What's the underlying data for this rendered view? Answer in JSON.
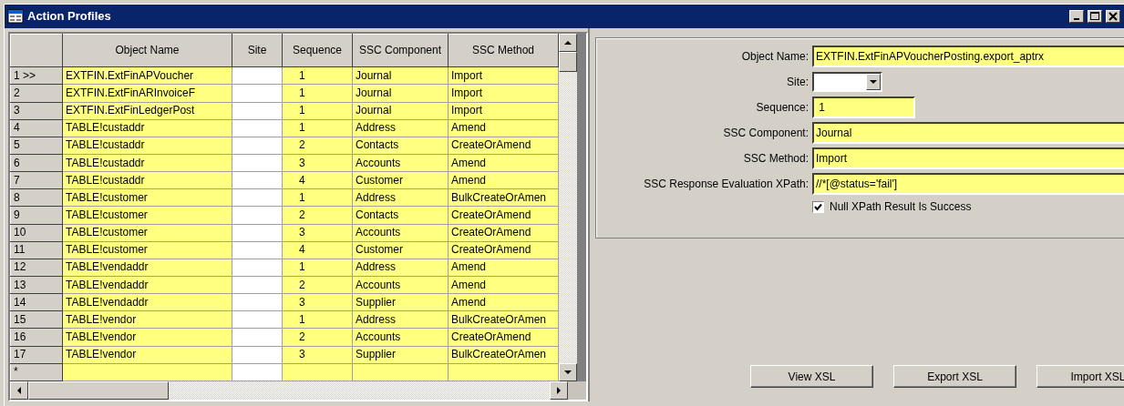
{
  "window": {
    "title": "Action Profiles"
  },
  "grid": {
    "columns": [
      "Object Name",
      "Site",
      "Sequence",
      "SSC Component",
      "SSC Method"
    ],
    "rows": [
      {
        "header": "1 >>",
        "cells": [
          "EXTFIN.ExtFinAPVoucher",
          "",
          "1",
          "Journal",
          "Import"
        ]
      },
      {
        "header": "2",
        "cells": [
          "EXTFIN.ExtFinARInvoiceF",
          "",
          "1",
          "Journal",
          "Import"
        ]
      },
      {
        "header": "3",
        "cells": [
          "EXTFIN.ExtFinLedgerPost",
          "",
          "1",
          "Journal",
          "Import"
        ]
      },
      {
        "header": "4",
        "cells": [
          "TABLE!custaddr",
          "",
          "1",
          "Address",
          "Amend"
        ]
      },
      {
        "header": "5",
        "cells": [
          "TABLE!custaddr",
          "",
          "2",
          "Contacts",
          "CreateOrAmend"
        ]
      },
      {
        "header": "6",
        "cells": [
          "TABLE!custaddr",
          "",
          "3",
          "Accounts",
          "Amend"
        ]
      },
      {
        "header": "7",
        "cells": [
          "TABLE!custaddr",
          "",
          "4",
          "Customer",
          "Amend"
        ]
      },
      {
        "header": "8",
        "cells": [
          "TABLE!customer",
          "",
          "1",
          "Address",
          "BulkCreateOrAmen"
        ]
      },
      {
        "header": "9",
        "cells": [
          "TABLE!customer",
          "",
          "2",
          "Contacts",
          "CreateOrAmend"
        ]
      },
      {
        "header": "10",
        "cells": [
          "TABLE!customer",
          "",
          "3",
          "Accounts",
          "CreateOrAmend"
        ]
      },
      {
        "header": "11",
        "cells": [
          "TABLE!customer",
          "",
          "4",
          "Customer",
          "CreateOrAmend"
        ]
      },
      {
        "header": "12",
        "cells": [
          "TABLE!vendaddr",
          "",
          "1",
          "Address",
          "Amend"
        ]
      },
      {
        "header": "13",
        "cells": [
          "TABLE!vendaddr",
          "",
          "2",
          "Accounts",
          "Amend"
        ]
      },
      {
        "header": "14",
        "cells": [
          "TABLE!vendaddr",
          "",
          "3",
          "Supplier",
          "Amend"
        ]
      },
      {
        "header": "15",
        "cells": [
          "TABLE!vendor",
          "",
          "1",
          "Address",
          "BulkCreateOrAmen"
        ]
      },
      {
        "header": "16",
        "cells": [
          "TABLE!vendor",
          "",
          "2",
          "Accounts",
          "CreateOrAmend"
        ]
      },
      {
        "header": "17",
        "cells": [
          "TABLE!vendor",
          "",
          "3",
          "Supplier",
          "BulkCreateOrAmen"
        ]
      }
    ],
    "new_row_marker": "*"
  },
  "details": {
    "fields": [
      {
        "label": "Object Name:",
        "kind": "text",
        "value": "EXTFIN.ExtFinAPVoucherPosting.export_aptrx"
      },
      {
        "label": "Site:",
        "kind": "combo"
      },
      {
        "label": "Sequence:",
        "kind": "short",
        "value": " 1"
      },
      {
        "label": "SSC Component:",
        "kind": "text",
        "value": "Journal"
      },
      {
        "label": "SSC Method:",
        "kind": "text",
        "value": "Import"
      },
      {
        "label": "SSC Response Evaluation XPath:",
        "kind": "text",
        "value": "//*[@status='fail']"
      }
    ],
    "checkbox": {
      "label": "Null XPath Result Is Success",
      "checked": true
    }
  },
  "buttons": [
    "View XSL",
    "Export XSL",
    "Import XSL"
  ]
}
